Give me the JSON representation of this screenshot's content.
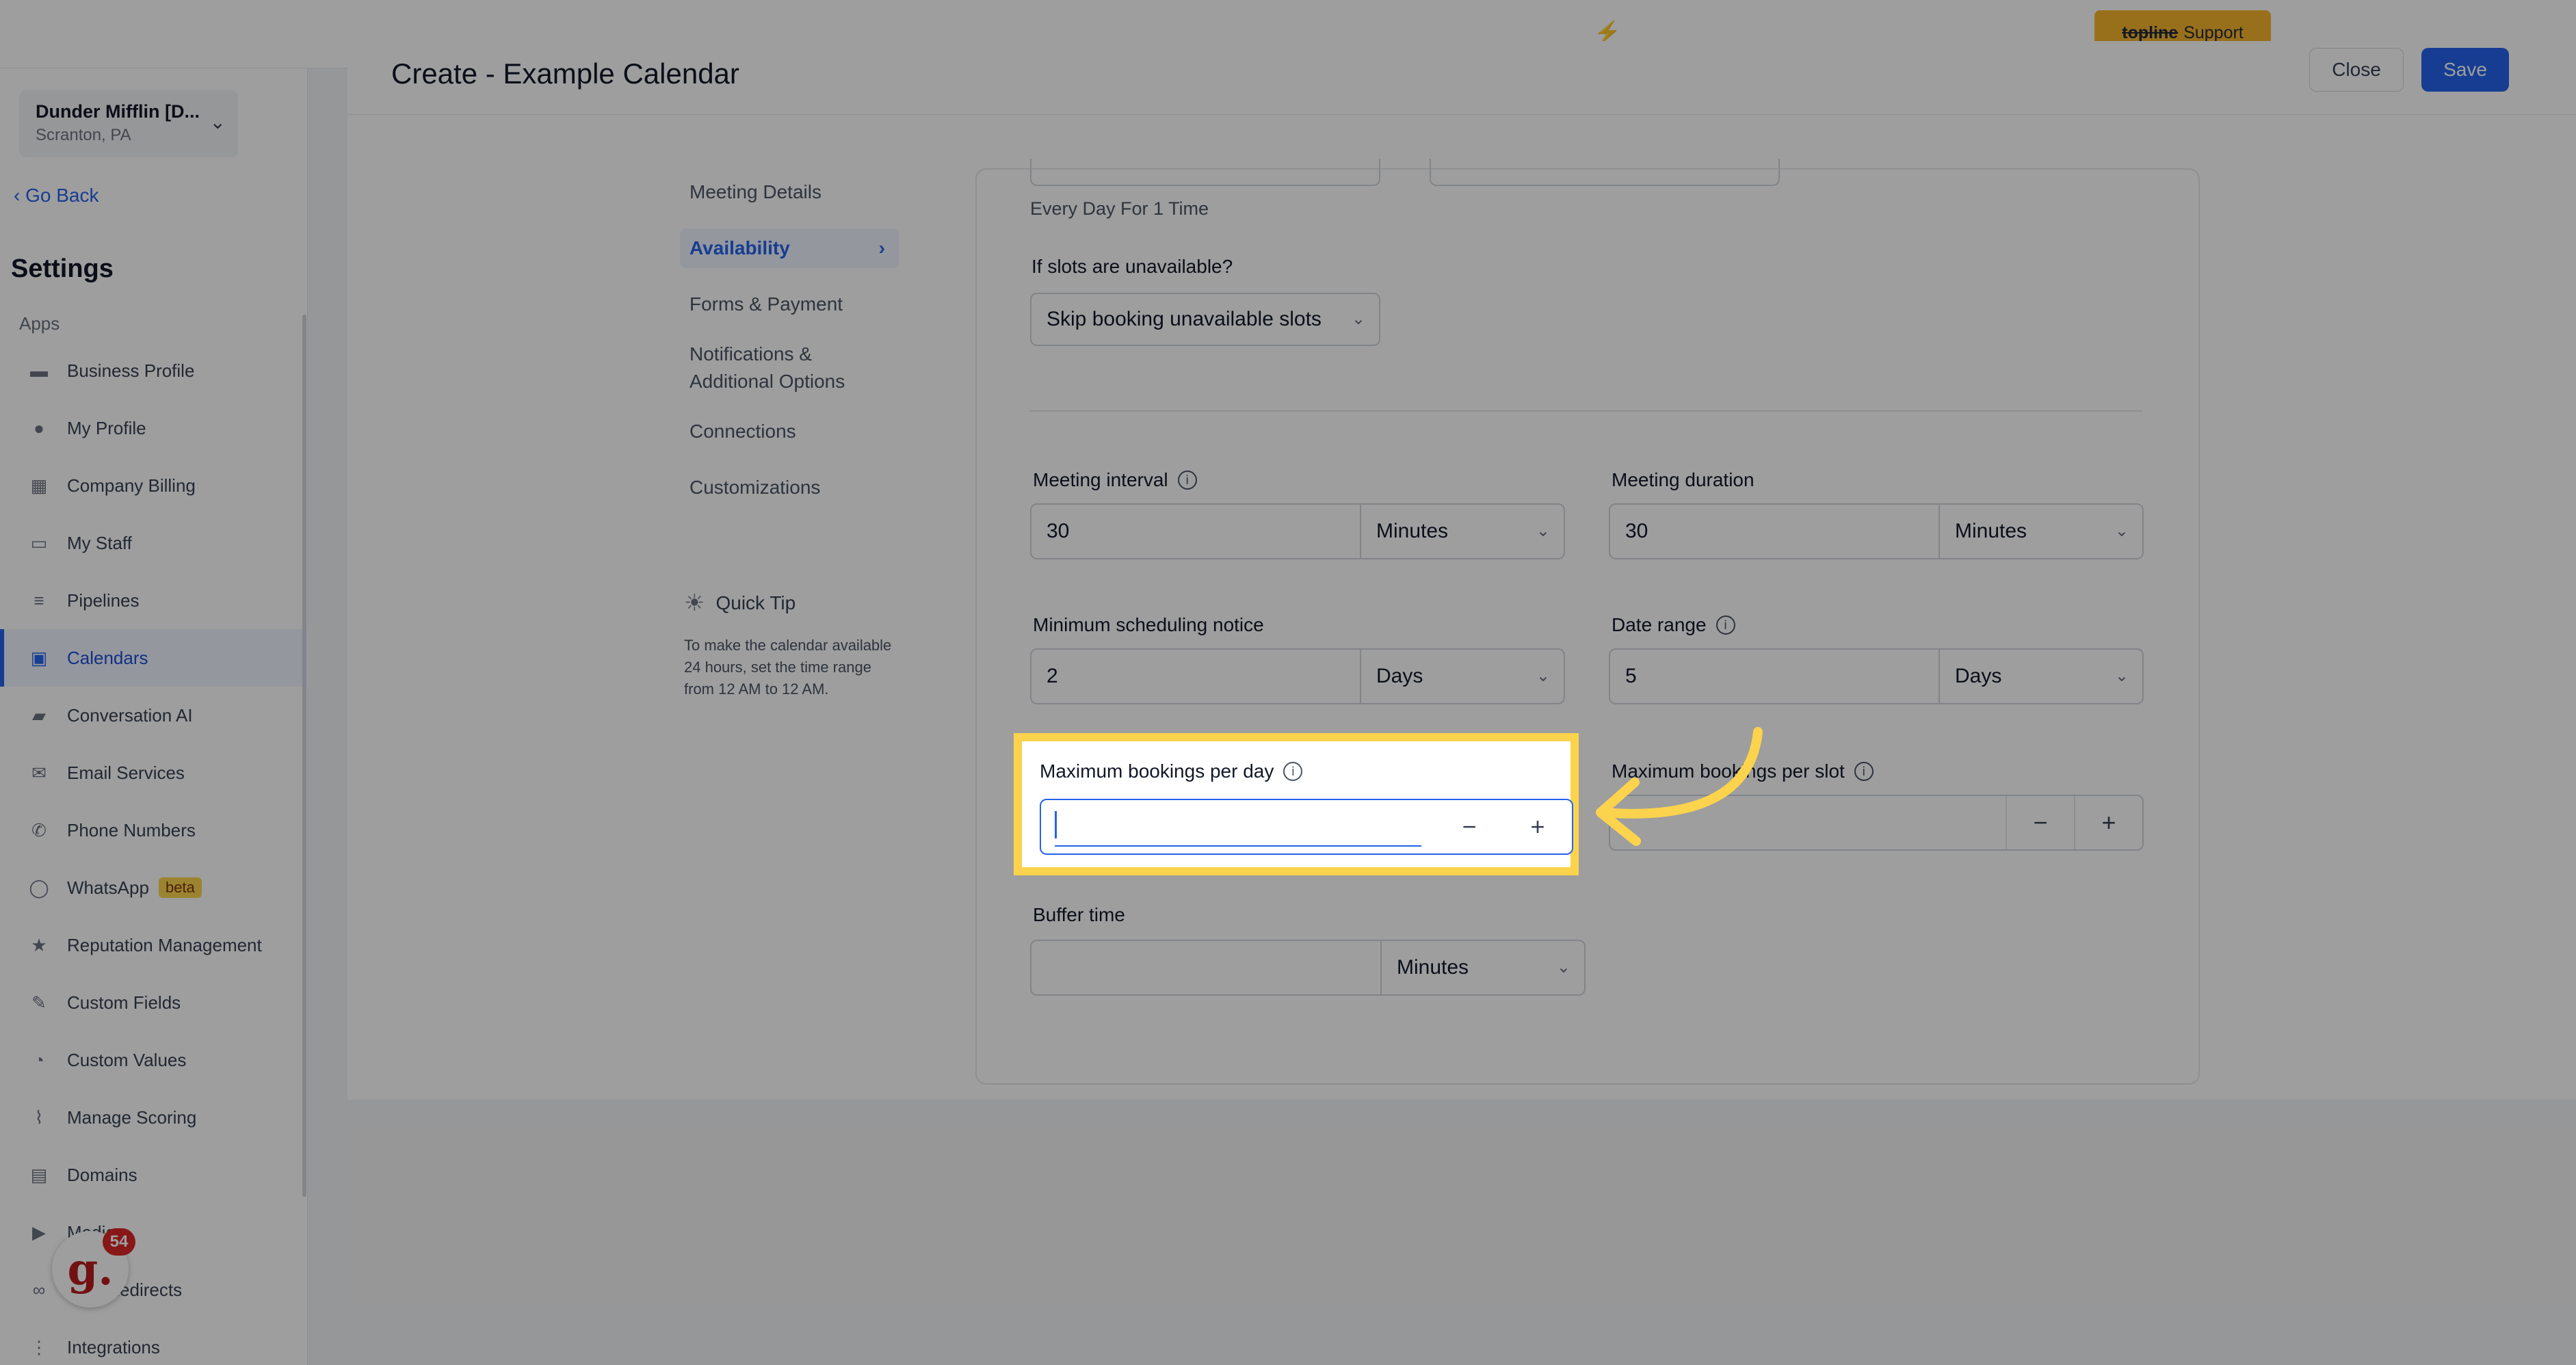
{
  "topbar": {
    "support_strike": "topline",
    "support_text": "Support",
    "bolt": "⚡"
  },
  "sidebar": {
    "account": {
      "name": "Dunder Mifflin [D...",
      "location": "Scranton, PA"
    },
    "go_back": "Go Back",
    "title": "Settings",
    "section": "Apps",
    "items": [
      {
        "label": "Business Profile",
        "icon": "briefcase-icon",
        "glyph": "▬"
      },
      {
        "label": "My Profile",
        "icon": "user-icon",
        "glyph": "●"
      },
      {
        "label": "Company Billing",
        "icon": "grid-icon",
        "glyph": "▦"
      },
      {
        "label": "My Staff",
        "icon": "inbox-icon",
        "glyph": "▭"
      },
      {
        "label": "Pipelines",
        "icon": "filter-icon",
        "glyph": "≡"
      },
      {
        "label": "Calendars",
        "icon": "calendar-icon",
        "glyph": "▣"
      },
      {
        "label": "Conversation AI",
        "icon": "chat-icon",
        "glyph": "▰"
      },
      {
        "label": "Email Services",
        "icon": "email-icon",
        "glyph": "✉"
      },
      {
        "label": "Phone Numbers",
        "icon": "phone-icon",
        "glyph": "✆"
      },
      {
        "label": "WhatsApp",
        "icon": "whatsapp-icon",
        "glyph": "◯",
        "badge": "beta"
      },
      {
        "label": "Reputation Management",
        "icon": "star-icon",
        "glyph": "★"
      },
      {
        "label": "Custom Fields",
        "icon": "edit-icon",
        "glyph": "✎"
      },
      {
        "label": "Custom Values",
        "icon": "pie-icon",
        "glyph": "◔"
      },
      {
        "label": "Manage Scoring",
        "icon": "chart-icon",
        "glyph": "⌇"
      },
      {
        "label": "Domains",
        "icon": "server-icon",
        "glyph": "▤"
      },
      {
        "label": "Media",
        "icon": "video-icon",
        "glyph": "▶"
      },
      {
        "label": "URL Redirects",
        "icon": "link-icon",
        "glyph": "∞"
      },
      {
        "label": "Integrations",
        "icon": "integrations-icon",
        "glyph": "⋮"
      }
    ],
    "notif_count": "54"
  },
  "header": {
    "title": "Create - Example Calendar",
    "close_label": "Close",
    "save_label": "Save"
  },
  "steps": {
    "s1": "Meeting Details",
    "s2": "Availability",
    "s3": "Forms & Payment",
    "s4a": "Notifications &",
    "s4b": "Additional Options",
    "s5": "Connections",
    "s6": "Customizations"
  },
  "quick_tip": {
    "title": "Quick Tip",
    "body": "To make the calendar available 24 hours, set the time range from 12 AM to 12 AM."
  },
  "form": {
    "frequency_text": "Every Day For 1 Time",
    "unavailable_label": "If slots are unavailable?",
    "unavailable_value": "Skip booking unavailable slots",
    "meeting_interval": {
      "label": "Meeting interval",
      "value": "30",
      "unit": "Minutes"
    },
    "meeting_duration": {
      "label": "Meeting duration",
      "value": "30",
      "unit": "Minutes"
    },
    "min_notice": {
      "label": "Minimum scheduling notice",
      "value": "2",
      "unit": "Days"
    },
    "date_range": {
      "label": "Date range",
      "value": "5",
      "unit": "Days"
    },
    "max_per_day": {
      "label": "Maximum bookings per day",
      "value": ""
    },
    "max_per_slot": {
      "label": "Maximum bookings per slot",
      "value": ""
    },
    "buffer_time": {
      "label": "Buffer time",
      "value": "",
      "unit": "Minutes"
    }
  },
  "colors": {
    "accent": "#2563eb",
    "highlight": "#fcd34d",
    "support": "#f5b52e"
  }
}
